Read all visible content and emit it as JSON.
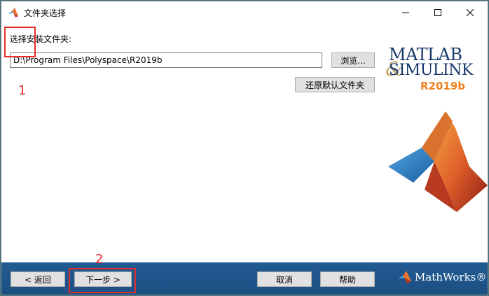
{
  "window": {
    "title": "文件夹选择",
    "minimize_icon": "minimize-icon",
    "maximize_icon": "maximize-icon",
    "close_icon": "close-icon"
  },
  "content": {
    "folder_label": "选择安装文件夹:",
    "path_value": "D:\\Program Files\\Polyspace\\R2019b",
    "browse_label": "浏览...",
    "restore_default_label": "还原默认文件夹"
  },
  "logo": {
    "matlab": "MATLAB",
    "amp": "&",
    "simulink": "SIMULINK",
    "registered": "®",
    "release": "R2019b"
  },
  "footer": {
    "back_label": "< 返回",
    "next_label": "下一步 >",
    "cancel_label": "取消",
    "help_label": "帮助",
    "mathworks": "MathWorks®"
  },
  "annotations": {
    "step1": "1",
    "step2": "2",
    "color": "#e52d2d"
  },
  "colors": {
    "bottom_bar": "#1f5689",
    "logo_text": "#17396b",
    "release_text": "#f08020"
  }
}
